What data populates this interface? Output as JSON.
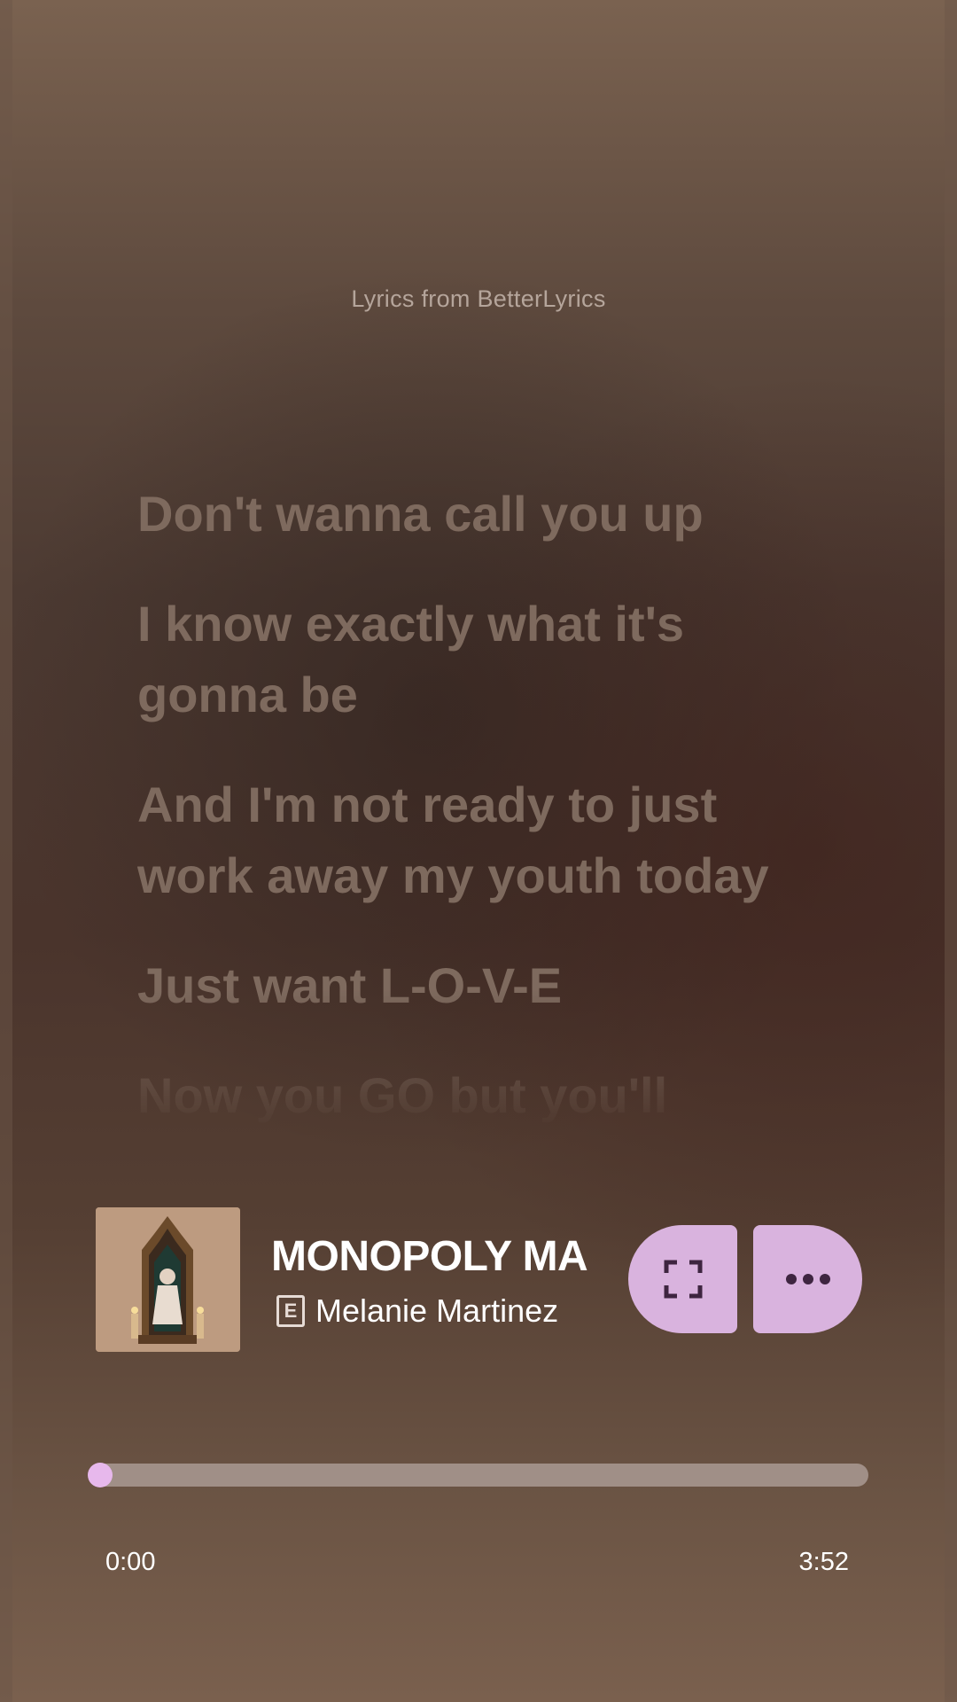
{
  "lyrics": {
    "source": "Lyrics from BetterLyrics",
    "lines": [
      "Don't wanna call you up",
      "I know exactly what it's gonna be",
      "And I'm not ready to just work away my youth today",
      "Just want L-O-V-E",
      "Now you GO but you'll"
    ]
  },
  "now_playing": {
    "title": "MONOPOLY MA",
    "explicit_label": "E",
    "artist": "Melanie Martinez",
    "fullscreen_icon": "fullscreen-icon",
    "more_icon": "more-horizontal-icon"
  },
  "playback": {
    "progress_fraction": 0.0,
    "current_time": "0:00",
    "total_time": "3:52"
  },
  "colors": {
    "accent": "#d9b3de",
    "progress_fill": "#e7b8ec",
    "track": "#a08f87"
  }
}
